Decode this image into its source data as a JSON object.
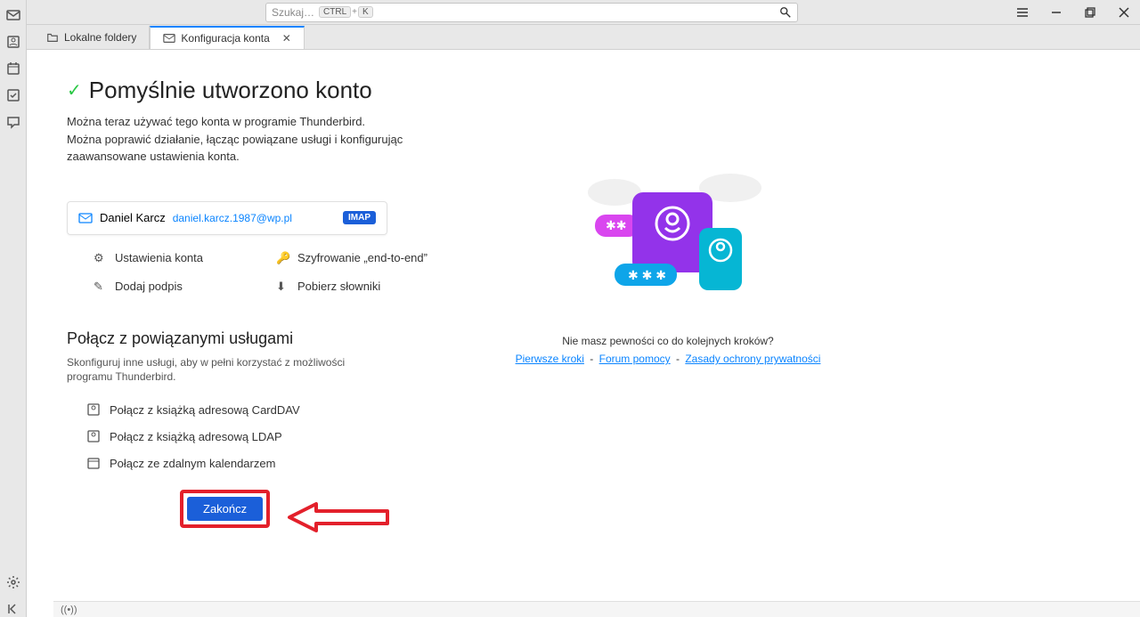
{
  "search": {
    "placeholder": "Szukaj…",
    "kbd1": "CTRL",
    "kbd2": "K"
  },
  "tabs": {
    "local": "Lokalne foldery",
    "config": "Konfiguracja konta"
  },
  "success": {
    "title": "Pomyślnie utworzono konto",
    "line1": "Można teraz używać tego konta w programie Thunderbird.",
    "line2": "Można poprawić działanie, łącząc powiązane usługi i konfigurując zaawansowane ustawienia konta."
  },
  "account": {
    "name": "Daniel Karcz",
    "email": "daniel.karcz.1987@wp.pl",
    "protocol": "IMAP"
  },
  "options": {
    "settings": "Ustawienia konta",
    "encryption": "Szyfrowanie „end-to-end”",
    "signature": "Dodaj podpis",
    "dicts": "Pobierz słowniki"
  },
  "services": {
    "title": "Połącz z powiązanymi usługami",
    "desc": "Skonfiguruj inne usługi, aby w pełni korzystać z możliwości programu Thunderbird.",
    "carddav": "Połącz z książką adresową CardDAV",
    "ldap": "Połącz z książką adresową LDAP",
    "calendar": "Połącz ze zdalnym kalendarzem"
  },
  "finish": "Zakończ",
  "help": {
    "question": "Nie masz pewności co do kolejnych kroków?",
    "first_steps": "Pierwsze kroki",
    "forum": "Forum pomocy",
    "privacy": "Zasady ochrony prywatności"
  },
  "status": "((•))"
}
